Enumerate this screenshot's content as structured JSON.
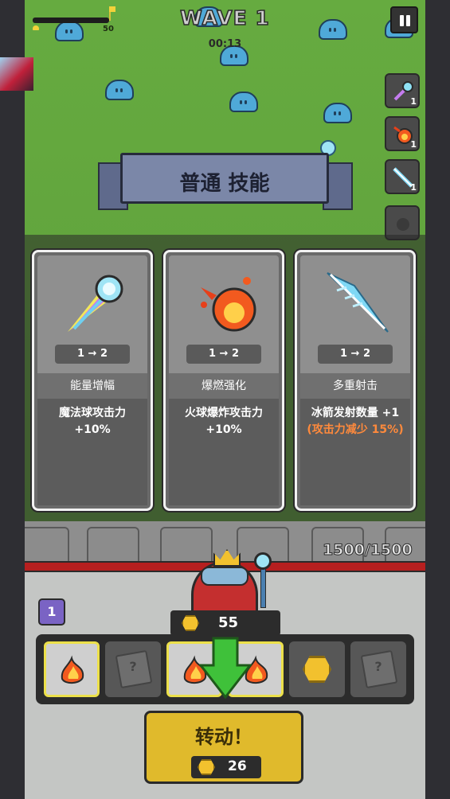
{
  "hud": {
    "xp_value": "50",
    "wave_title": "WAVE 1",
    "timer": "00:13",
    "pause_icon": "pause-icon"
  },
  "skill_slots": [
    {
      "icon": "energy-orb-icon",
      "count": "1"
    },
    {
      "icon": "fireball-icon",
      "count": "1"
    },
    {
      "icon": "ice-arrow-icon",
      "count": "1"
    },
    {
      "icon": "empty-slot-icon",
      "count": ""
    }
  ],
  "banner": {
    "title": "普通 技能"
  },
  "cards": [
    {
      "icon": "energy-orb-icon",
      "level": "1 → 2",
      "name": "能量增幅",
      "desc_line1": "魔法球攻击力",
      "desc_line2": "+10%",
      "warn": ""
    },
    {
      "icon": "fireball-icon",
      "level": "1 → 2",
      "name": "爆燃强化",
      "desc_line1": "火球爆炸攻击力",
      "desc_line2": "+10%",
      "warn": ""
    },
    {
      "icon": "ice-arrow-icon",
      "level": "1 → 2",
      "name": "多重射击",
      "desc_line1": "冰箭发射数量 +1",
      "desc_line2": "",
      "warn": "(攻击力减少 15%)"
    }
  ],
  "castle": {
    "hp": "1500/1500"
  },
  "player": {
    "level": "1",
    "coins": "55"
  },
  "reel": [
    {
      "type": "fire",
      "highlight": true
    },
    {
      "type": "unknown",
      "highlight": false
    },
    {
      "type": "fire",
      "highlight": true
    },
    {
      "type": "fire",
      "highlight": true
    },
    {
      "type": "coin",
      "highlight": false
    },
    {
      "type": "unknown",
      "highlight": false
    }
  ],
  "spin": {
    "label": "转动！",
    "cost": "26"
  },
  "colors": {
    "grass": "#5e9f3a",
    "accent_gold": "#e0ba2c",
    "hp_red": "#b61f1f",
    "warn_orange": "#ff8a3c"
  }
}
